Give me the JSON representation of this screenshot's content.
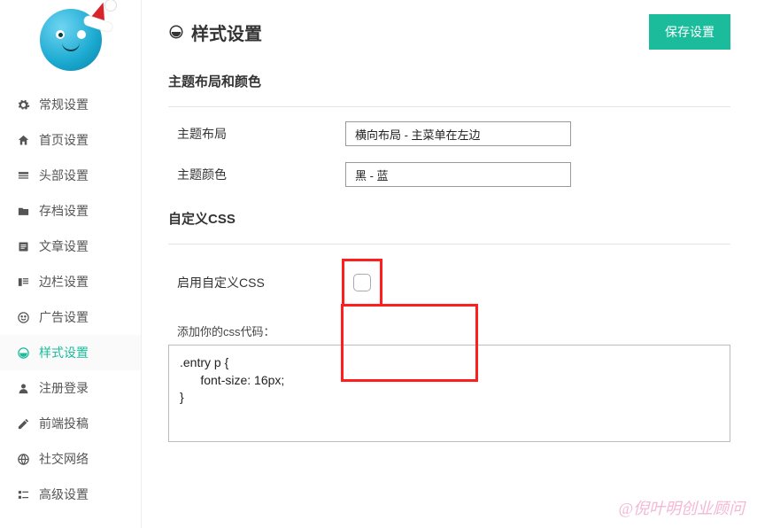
{
  "sidebar": {
    "items": [
      {
        "icon": "gear-icon",
        "label": "常规设置"
      },
      {
        "icon": "home-icon",
        "label": "首页设置"
      },
      {
        "icon": "header-icon",
        "label": "头部设置"
      },
      {
        "icon": "archive-icon",
        "label": "存档设置"
      },
      {
        "icon": "article-icon",
        "label": "文章设置"
      },
      {
        "icon": "sidebar-icon",
        "label": "边栏设置"
      },
      {
        "icon": "ad-icon",
        "label": "广告设置"
      },
      {
        "icon": "style-icon",
        "label": "样式设置"
      },
      {
        "icon": "user-icon",
        "label": "注册登录"
      },
      {
        "icon": "post-icon",
        "label": "前端投稿"
      },
      {
        "icon": "globe-icon",
        "label": "社交网络"
      },
      {
        "icon": "advanced-icon",
        "label": "高级设置"
      }
    ],
    "active_index": 7
  },
  "header": {
    "title": "样式设置",
    "save_label": "保存设置"
  },
  "section_layout": {
    "title": "主题布局和颜色",
    "layout_label": "主题布局",
    "layout_value": "横向布局 - 主菜单在左边",
    "color_label": "主题颜色",
    "color_value": "黑 - 蓝"
  },
  "section_css": {
    "title": "自定义CSS",
    "enable_label": "启用自定义CSS",
    "enable_checked": false,
    "code_label": "添加你的css代码：",
    "code_value": ".entry p {\n      font-size: 16px;\n}"
  },
  "watermark": "@倪叶明创业顾问"
}
